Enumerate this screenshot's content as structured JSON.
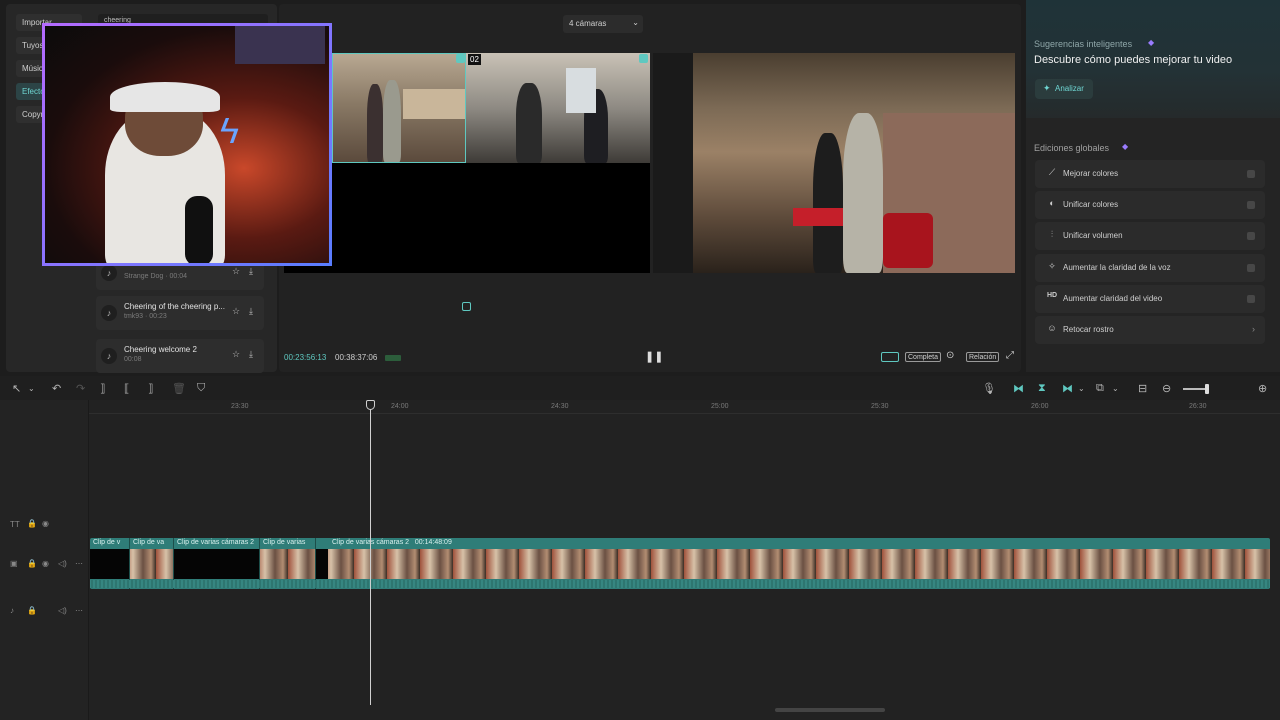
{
  "left_nav": {
    "items": [
      "Importar",
      "Tuyos",
      "Música",
      "Efectos",
      "Copyright"
    ],
    "search_value": "cheering",
    "tracks": [
      {
        "title": "",
        "meta": "Strange Dog · 00:04"
      },
      {
        "title": "Cheering of the cheering p...",
        "meta": "tmk93 · 00:23"
      },
      {
        "title": "Cheering welcome 2",
        "meta": "00:08"
      }
    ]
  },
  "preview": {
    "camera_select": "4 cámaras",
    "cam_label": "02",
    "current_time": "00:23:56:13",
    "total_time": "00:38:37:06",
    "complete_label": "Completa",
    "ratio_label": "Relación"
  },
  "right_panel": {
    "suggestions_title": "Sugerencias inteligentes",
    "suggestions_heading": "Descubre cómo puedes mejorar tu video",
    "analyze_label": "Analizar",
    "global_title": "Ediciones globales",
    "items": [
      {
        "icon": "wand-icon",
        "glyph": "⟋",
        "label": "Mejorar colores"
      },
      {
        "icon": "palette-icon",
        "glyph": "◐",
        "label": "Unificar colores"
      },
      {
        "icon": "sliders-icon",
        "glyph": "⫶",
        "label": "Unificar volumen"
      },
      {
        "icon": "voice-icon",
        "glyph": "✧",
        "label": "Aumentar la claridad de la voz"
      },
      {
        "icon": "hd-icon",
        "glyph": "HD",
        "label": "Aumentar claridad del video"
      },
      {
        "icon": "face-icon",
        "glyph": "☺",
        "label": "Retocar rostro"
      }
    ]
  },
  "timeline": {
    "ticks": [
      "23:30",
      "24:00",
      "24:30",
      "25:00",
      "25:30",
      "26:00",
      "26:30"
    ],
    "clips": [
      {
        "label": "Clip de v"
      },
      {
        "label": "Clip de va"
      },
      {
        "label": "Clip de varias cámaras 2"
      },
      {
        "label": "Clip de varias"
      },
      {
        "label": "Clip de varias cámaras 2   00:14:48:09"
      }
    ]
  },
  "colors": {
    "accent": "#5fc8c0",
    "clip": "#2f7d78"
  }
}
